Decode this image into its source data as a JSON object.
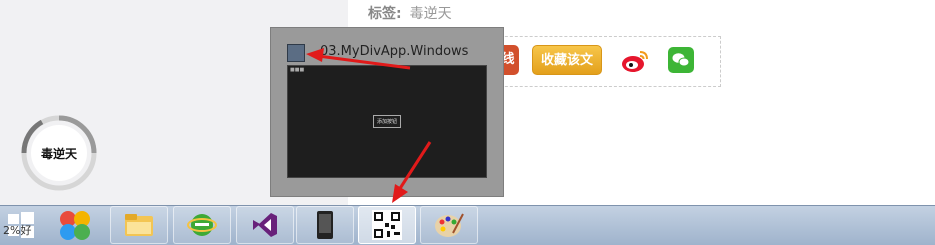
{
  "page": {
    "tag_label": "标签:",
    "tag_value": "毒逆天"
  },
  "share": {
    "partial_button": "线",
    "favorite_button": "收藏该文",
    "weibo_icon": "weibo-icon",
    "wechat_icon": "wechat-icon"
  },
  "avatar": {
    "text": "毒逆天"
  },
  "preview": {
    "title": "03.MyDivApp.Windows",
    "thumb_dots": "■■■",
    "thumb_button": "添加按钮"
  },
  "taskbar": {
    "clock_fragment": "2%好",
    "apps": [
      {
        "name": "start",
        "icon": "windows-logo-icon"
      },
      {
        "name": "app-colorful",
        "icon": "colorful-petals-icon"
      },
      {
        "name": "file-explorer",
        "icon": "folder-icon"
      },
      {
        "name": "ie",
        "icon": "internet-explorer-icon"
      },
      {
        "name": "visual-studio",
        "icon": "visual-studio-icon"
      },
      {
        "name": "phone-emulator",
        "icon": "phone-icon"
      },
      {
        "name": "qr-app",
        "icon": "qr-code-icon",
        "active": true
      },
      {
        "name": "paint",
        "icon": "paint-palette-icon"
      }
    ]
  },
  "colors": {
    "accent_arrow": "#e11a1a",
    "favorite_button": "#f0b53a",
    "taskbar": "#a9bcd2"
  }
}
